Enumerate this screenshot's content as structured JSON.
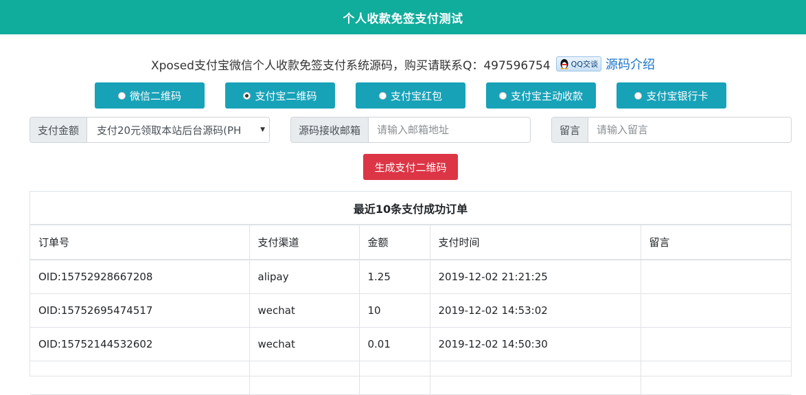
{
  "header": {
    "title": "个人收款免签支付测试"
  },
  "intro": {
    "text": "Xposed支付宝微信个人收款免签支付系统源码，购买请联系Q：497596754",
    "qq_badge": "QQ交谈",
    "link": "源码介绍"
  },
  "pay_channels": [
    {
      "label": "微信二维码",
      "checked": false
    },
    {
      "label": "支付宝二维码",
      "checked": true
    },
    {
      "label": "支付宝红包",
      "checked": false
    },
    {
      "label": "支付宝主动收款",
      "checked": false
    },
    {
      "label": "支付宝银行卡",
      "checked": false
    }
  ],
  "form": {
    "amount_label": "支付金额",
    "amount_value": "支付20元领取本站后台源码(PH",
    "email_label": "源码接收邮箱",
    "email_placeholder": "请输入邮箱地址",
    "message_label": "留言",
    "message_placeholder": "请输入留言",
    "submit_label": "生成支付二维码"
  },
  "orders": {
    "title": "最近10条支付成功订单",
    "columns": [
      "订单号",
      "支付渠道",
      "金额",
      "支付时间",
      "留言"
    ],
    "rows": [
      [
        "OID:15752928667208",
        "alipay",
        "1.25",
        "2019-12-02 21:21:25",
        ""
      ],
      [
        "OID:15752695474517",
        "wechat",
        "10",
        "2019-12-02 14:53:02",
        ""
      ],
      [
        "OID:15752144532602",
        "wechat",
        "0.01",
        "2019-12-02 14:50:30",
        ""
      ]
    ]
  },
  "colors": {
    "header": "#10ac9c",
    "channel_button": "#17a2b8",
    "submit_button": "#dc3545",
    "link": "#1a73c9"
  }
}
